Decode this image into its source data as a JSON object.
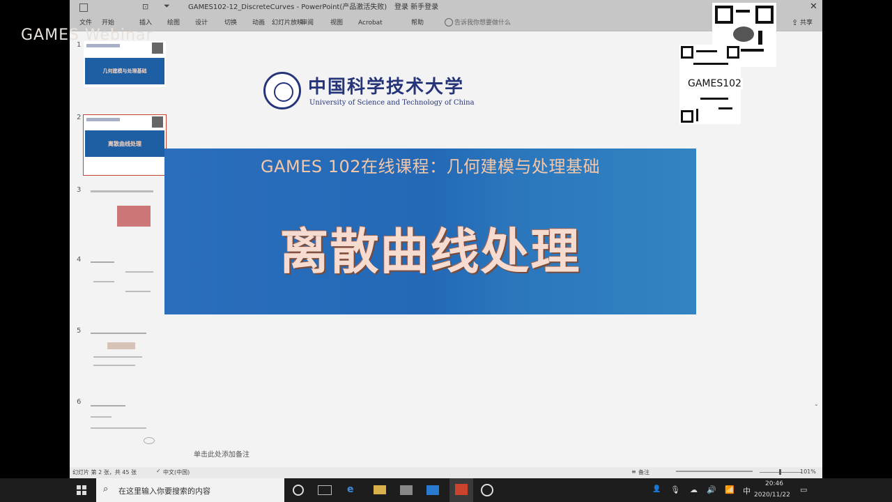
{
  "overlay": {
    "watermark": "GAMES Webinar"
  },
  "window": {
    "title": "GAMES102-12_DiscreteCurves - PowerPoint(产品激活失败)",
    "signin": "登录 新手登录",
    "share": "共享"
  },
  "ribbon": {
    "tabs": [
      "文件",
      "开始",
      "插入",
      "绘图",
      "设计",
      "切换",
      "动画",
      "幻灯片放映",
      "审阅",
      "视图",
      "Acrobat",
      "帮助"
    ],
    "search_placeholder": "告诉我你想要做什么"
  },
  "thumbnails": [
    {
      "num": "1",
      "title": "几何建模与处理基础"
    },
    {
      "num": "2",
      "title": "离散曲线处理"
    },
    {
      "num": "3"
    },
    {
      "num": "4"
    },
    {
      "num": "5"
    },
    {
      "num": "6"
    }
  ],
  "slide": {
    "university_cn": "中国科学技术大学",
    "university_en": "University of Science and Technology of China",
    "course_title": "GAMES 102在线课程：几何建模与处理基础",
    "lecture_title": "离散曲线处理",
    "qr_label": "GAMES102",
    "notes_placeholder": "单击此处添加备注"
  },
  "statusbar": {
    "slide_info": "幻灯片 第 2 张，共 45 张",
    "language": "中文(中国)",
    "notes_button": "备注",
    "zoom": "101%"
  },
  "taskbar": {
    "search_placeholder": "在这里输入你要搜索的内容",
    "ime": "中",
    "time": "20:46",
    "date": "2020/11/22"
  },
  "colors": {
    "banner_blue": "#2369b6",
    "title_peach": "#f4c7a9",
    "ustc_navy": "#26357a",
    "taskbar": "#1d1d1d"
  }
}
